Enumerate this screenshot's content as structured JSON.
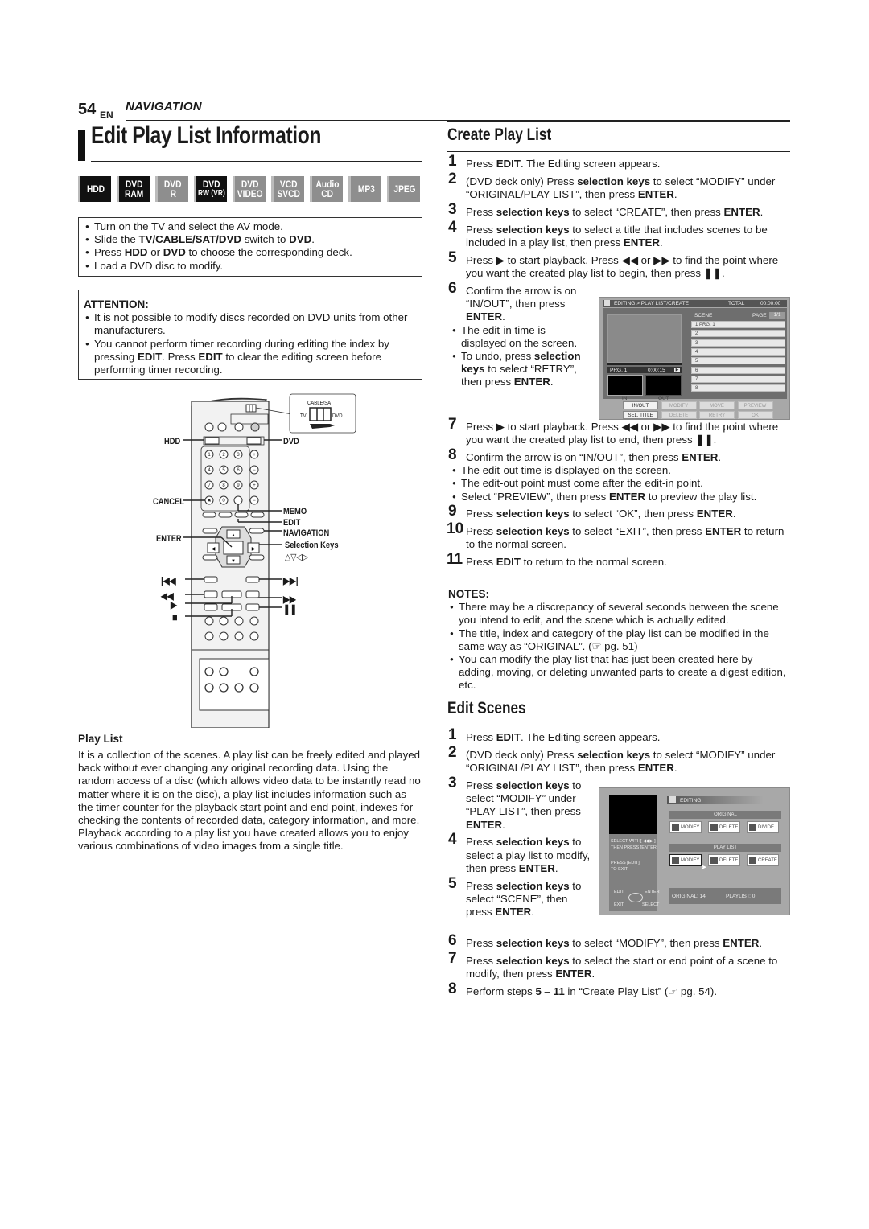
{
  "header": {
    "page_number": "54",
    "lang": "EN",
    "section": "NAVIGATION"
  },
  "page_title": "Edit Play List Information",
  "badges": [
    {
      "line1": "HDD",
      "line2": "",
      "active": true
    },
    {
      "line1": "DVD",
      "line2": "RAM",
      "active": true
    },
    {
      "line1": "DVD",
      "line2": "R",
      "active": false
    },
    {
      "line1": "DVD",
      "line2": "RW (VR)",
      "active": true
    },
    {
      "line1": "DVD",
      "line2": "VIDEO",
      "active": false
    },
    {
      "line1": "VCD",
      "line2": "SVCD",
      "active": false
    },
    {
      "line1": "Audio",
      "line2": "CD",
      "active": false
    },
    {
      "line1": "MP3",
      "line2": "",
      "active": false
    },
    {
      "line1": "JPEG",
      "line2": "",
      "active": false
    }
  ],
  "preparation": [
    {
      "pre": "Turn on the TV and select the AV mode.",
      "b1": "",
      "mid": "",
      "b2": "",
      "post": ""
    },
    {
      "pre": "Slide the ",
      "b1": "TV/CABLE/SAT/DVD",
      "mid": " switch to ",
      "b2": "DVD",
      "post": "."
    },
    {
      "pre": "Press ",
      "b1": "HDD",
      "mid": " or ",
      "b2": "DVD",
      "post": " to choose the corresponding deck."
    },
    {
      "pre": "Load a DVD disc to modify.",
      "b1": "",
      "mid": "",
      "b2": "",
      "post": ""
    }
  ],
  "attention": {
    "heading": "ATTENTION:",
    "item1": "It is not possible to modify discs recorded on DVD units from other manufacturers.",
    "item2_a": "You cannot perform timer recording during editing the index by pressing ",
    "item2_b": "EDIT",
    "item2_c": ". Press ",
    "item2_d": "EDIT",
    "item2_e": " to clear the editing screen before performing timer recording."
  },
  "remote": {
    "switch_top": "CABLE/SAT",
    "switch_left": "TV",
    "switch_right": "DVD",
    "labels": {
      "hdd": "HDD",
      "dvd": "DVD",
      "cancel": "CANCEL",
      "memo": "MEMO",
      "edit": "EDIT",
      "enter": "ENTER",
      "navigation": "NAVIGATION",
      "selection_keys": "Selection Keys",
      "selection_arrows": "△▽◁▷",
      "prev": "|◀◀",
      "next": "▶▶|",
      "rew": "◀◀",
      "ffw": "▶▶",
      "play": "▶",
      "pause": "❚❚",
      "stop": "■"
    }
  },
  "play_list_info": {
    "heading": "Play List",
    "body": "It is a collection of the scenes. A play list can be freely edited and played back without ever changing any original recording data. Using the random access of a disc (which allows video data to be instantly read no matter where it is on the disc), a play list includes information such as the timer counter for the playback start point and end point, indexes for checking the contents of recorded data, category information, and more. Playback according to a play list you have created allows you to enjoy various combinations of video images from a single title."
  },
  "create_play_list": {
    "title": "Create Play List",
    "steps": [
      {
        "n": "1",
        "html": "Press <b>EDIT</b>. The Editing screen appears."
      },
      {
        "n": "2",
        "html": "(DVD deck only) Press <b>selection keys</b> to select “MODIFY” under “ORIGINAL/PLAY LIST”, then press <b>ENTER</b>."
      },
      {
        "n": "3",
        "html": "Press <b>selection keys</b> to select “CREATE”, then press <b>ENTER</b>."
      },
      {
        "n": "4",
        "html": "Press <b>selection keys</b> to select a title that includes scenes to be included in a play list, then press <b>ENTER</b>."
      },
      {
        "n": "5",
        "html": "Press ▶ to start playback. Press ◀◀ or ▶▶ to find the point where you want the created play list to begin, then press ❚❚."
      },
      {
        "n": "6",
        "html": "Confirm the arrow is on “IN/OUT”, then press <b>ENTER</b>."
      },
      {
        "n": "7",
        "html": "Press ▶ to start playback. Press ◀◀ or ▶▶ to find the point where you want the created play list to end, then press ❚❚."
      },
      {
        "n": "8",
        "html": "Confirm the arrow is on “IN/OUT”, then press <b>ENTER</b>."
      },
      {
        "n": "9",
        "html": "Press <b>selection keys</b> to select “OK”, then press <b>ENTER</b>."
      },
      {
        "n": "10",
        "html": "Press <b>selection keys</b> to select “EXIT”, then press <b>ENTER</b> to return to the normal screen."
      },
      {
        "n": "11",
        "html": "Press <b>EDIT</b> to return to the normal screen."
      }
    ],
    "step6_subs": [
      "The edit-in time is displayed on the screen.",
      "To undo, press <b>selection keys</b> to select “RETRY”, then press <b>ENTER</b>."
    ],
    "step8_subs": [
      "The edit-out time is displayed on the screen.",
      "The edit-out point must come after the edit-in point.",
      "Select “PREVIEW”, then press <b>ENTER</b> to preview the play list."
    ]
  },
  "osd_create": {
    "breadcrumb": "EDITING > PLAY LIST/CREATE",
    "total_label": "TOTAL",
    "total_value": "00:00:00",
    "scene_label": "SCENE",
    "page_label": "PAGE",
    "page_value": "1/1",
    "scenes": [
      "1   PRG. 1",
      "2",
      "3",
      "4",
      "5",
      "6",
      "7",
      "8"
    ],
    "preview_title": "PRG. 1",
    "preview_time": "0:00:15",
    "in_label": "IN",
    "out_label": "OUT",
    "buttons_row1": [
      "IN/OUT",
      "MODIFY",
      "MOVE",
      "PREVIEW"
    ],
    "buttons_row2": [
      "SEL. TITLE",
      "DELETE",
      "RETRY",
      "OK"
    ]
  },
  "notes": {
    "heading": "NOTES:",
    "items": [
      "There may be a discrepancy of several seconds between the scene you intend to edit, and the scene which is actually edited.",
      "The title, index and category of the play list can be modified in the same way as “ORIGINAL”. (☞ pg. 51)",
      "You can modify the play list that has just been created here by adding, moving, or deleting unwanted parts to create a digest edition, etc."
    ]
  },
  "edit_scenes": {
    "title": "Edit Scenes",
    "steps": [
      {
        "n": "1",
        "html": "Press <b>EDIT</b>. The Editing screen appears."
      },
      {
        "n": "2",
        "html": "(DVD deck only) Press <b>selection keys</b> to select “MODIFY” under “ORIGINAL/PLAY LIST”, then press <b>ENTER</b>."
      },
      {
        "n": "3",
        "html": "Press <b>selection keys</b> to select “MODIFY” under “PLAY LIST”, then press <b>ENTER</b>."
      },
      {
        "n": "4",
        "html": "Press <b>selection keys</b> to select a play list to modify, then press <b>ENTER</b>."
      },
      {
        "n": "5",
        "html": "Press <b>selection keys</b> to select “SCENE”, then press <b>ENTER</b>."
      },
      {
        "n": "6",
        "html": "Press <b>selection keys</b> to select “MODIFY”, then press <b>ENTER</b>."
      },
      {
        "n": "7",
        "html": "Press <b>selection keys</b> to select the start or end point of a scene to modify, then press <b>ENTER</b>."
      },
      {
        "n": "8",
        "html": "Perform steps <b>5</b> – <b>11</b> in “Create Play List” (☞ pg. 54)."
      }
    ]
  },
  "osd_editing": {
    "title": "EDITING",
    "original_label": "ORIGINAL",
    "original_buttons": [
      "MODIFY",
      "DELETE",
      "DIVIDE"
    ],
    "playlist_label": "PLAY LIST",
    "playlist_buttons": [
      "MODIFY",
      "DELETE",
      "CREATE"
    ],
    "help_line1": "SELECT WITH[ ◀◆▶ ]",
    "help_line2": "THEN PRESS [ENTER]",
    "help_line3": "PRESS [EDIT]",
    "help_line4": "TO EXIT",
    "key_edit": "EDIT",
    "key_exit": "EXIT",
    "key_enter": "ENTER",
    "key_select": "SELECT",
    "original_count": "ORIGINAL: 14",
    "playlist_count": "PLAYLIST: 0"
  }
}
